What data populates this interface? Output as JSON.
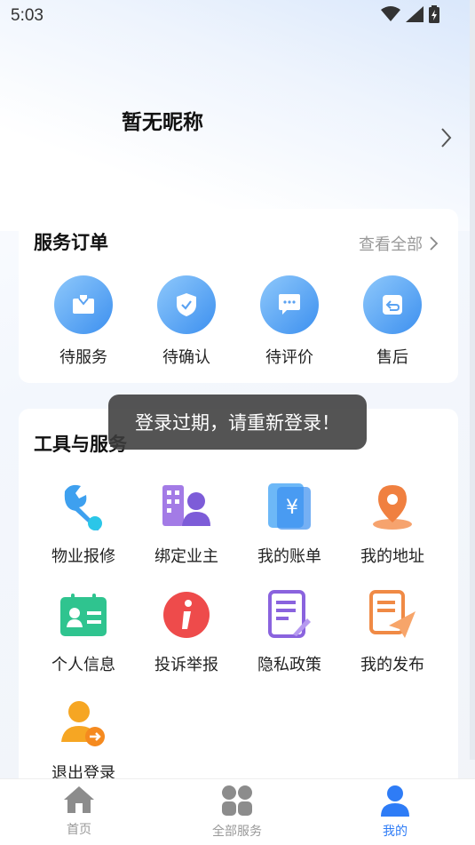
{
  "status_bar": {
    "time": "5:03"
  },
  "profile": {
    "nickname": "暂无昵称"
  },
  "orders": {
    "title": "服务订单",
    "view_all": "查看全部",
    "items": [
      {
        "label": "待服务",
        "icon": "briefcase-icon"
      },
      {
        "label": "待确认",
        "icon": "shield-check-icon"
      },
      {
        "label": "待评价",
        "icon": "chat-bubble-icon"
      },
      {
        "label": "售后",
        "icon": "return-icon"
      }
    ]
  },
  "tools": {
    "title": "工具与服务",
    "items": [
      {
        "label": "物业报修",
        "icon": "wrench-icon"
      },
      {
        "label": "绑定业主",
        "icon": "building-person-icon"
      },
      {
        "label": "我的账单",
        "icon": "bill-icon"
      },
      {
        "label": "我的地址",
        "icon": "location-pin-icon"
      },
      {
        "label": "个人信息",
        "icon": "id-card-icon"
      },
      {
        "label": "投诉举报",
        "icon": "info-icon"
      },
      {
        "label": "隐私政策",
        "icon": "document-edit-icon"
      },
      {
        "label": "我的发布",
        "icon": "paper-plane-icon"
      },
      {
        "label": "退出登录",
        "icon": "logout-person-icon"
      }
    ]
  },
  "toast": {
    "message": "登录过期，请重新登录！"
  },
  "tab_bar": {
    "tabs": [
      {
        "label": "首页",
        "icon": "home-icon"
      },
      {
        "label": "全部服务",
        "icon": "grid-icon"
      },
      {
        "label": "我的",
        "icon": "person-icon"
      }
    ],
    "active": "我的"
  },
  "colors": {
    "accent": "#2e7cf6",
    "order_icon": "#4a98f0"
  }
}
